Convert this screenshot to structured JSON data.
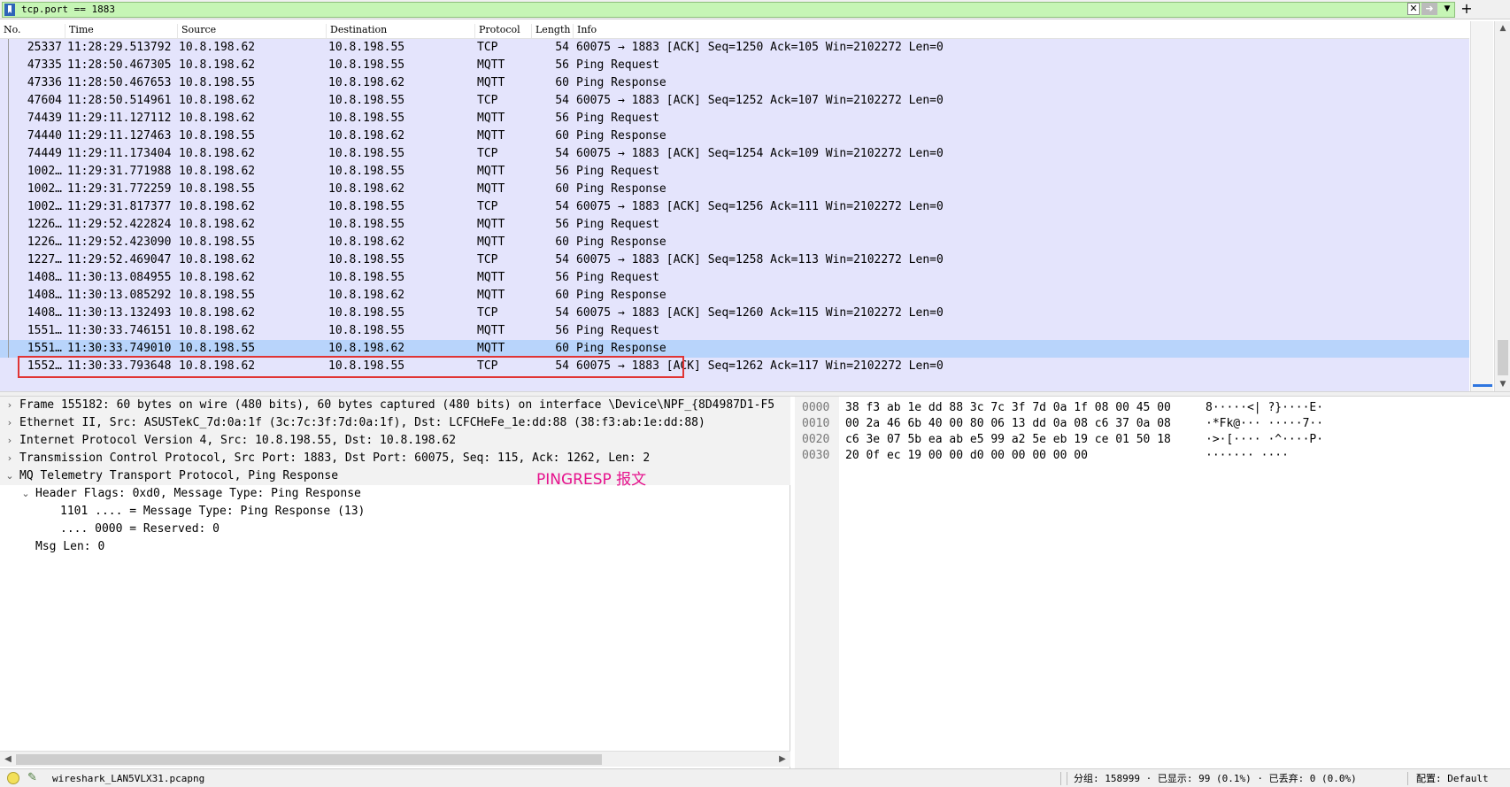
{
  "filter": {
    "value": "tcp.port == 1883"
  },
  "columns": [
    "No.",
    "Time",
    "Source",
    "Destination",
    "Protocol",
    "Length",
    "Info"
  ],
  "packets": [
    {
      "no": "25337",
      "time": "11:28:29.513792",
      "src": "10.8.198.62",
      "dst": "10.8.198.55",
      "proto": "TCP",
      "len": "54",
      "info": "60075 → 1883 [ACK] Seq=1250 Ack=105 Win=2102272 Len=0"
    },
    {
      "no": "47335",
      "time": "11:28:50.467305",
      "src": "10.8.198.62",
      "dst": "10.8.198.55",
      "proto": "MQTT",
      "len": "56",
      "info": "Ping Request"
    },
    {
      "no": "47336",
      "time": "11:28:50.467653",
      "src": "10.8.198.55",
      "dst": "10.8.198.62",
      "proto": "MQTT",
      "len": "60",
      "info": "Ping Response"
    },
    {
      "no": "47604",
      "time": "11:28:50.514961",
      "src": "10.8.198.62",
      "dst": "10.8.198.55",
      "proto": "TCP",
      "len": "54",
      "info": "60075 → 1883 [ACK] Seq=1252 Ack=107 Win=2102272 Len=0"
    },
    {
      "no": "74439",
      "time": "11:29:11.127112",
      "src": "10.8.198.62",
      "dst": "10.8.198.55",
      "proto": "MQTT",
      "len": "56",
      "info": "Ping Request"
    },
    {
      "no": "74440",
      "time": "11:29:11.127463",
      "src": "10.8.198.55",
      "dst": "10.8.198.62",
      "proto": "MQTT",
      "len": "60",
      "info": "Ping Response"
    },
    {
      "no": "74449",
      "time": "11:29:11.173404",
      "src": "10.8.198.62",
      "dst": "10.8.198.55",
      "proto": "TCP",
      "len": "54",
      "info": "60075 → 1883 [ACK] Seq=1254 Ack=109 Win=2102272 Len=0"
    },
    {
      "no": "1002…",
      "time": "11:29:31.771988",
      "src": "10.8.198.62",
      "dst": "10.8.198.55",
      "proto": "MQTT",
      "len": "56",
      "info": "Ping Request"
    },
    {
      "no": "1002…",
      "time": "11:29:31.772259",
      "src": "10.8.198.55",
      "dst": "10.8.198.62",
      "proto": "MQTT",
      "len": "60",
      "info": "Ping Response"
    },
    {
      "no": "1002…",
      "time": "11:29:31.817377",
      "src": "10.8.198.62",
      "dst": "10.8.198.55",
      "proto": "TCP",
      "len": "54",
      "info": "60075 → 1883 [ACK] Seq=1256 Ack=111 Win=2102272 Len=0"
    },
    {
      "no": "1226…",
      "time": "11:29:52.422824",
      "src": "10.8.198.62",
      "dst": "10.8.198.55",
      "proto": "MQTT",
      "len": "56",
      "info": "Ping Request"
    },
    {
      "no": "1226…",
      "time": "11:29:52.423090",
      "src": "10.8.198.55",
      "dst": "10.8.198.62",
      "proto": "MQTT",
      "len": "60",
      "info": "Ping Response"
    },
    {
      "no": "1227…",
      "time": "11:29:52.469047",
      "src": "10.8.198.62",
      "dst": "10.8.198.55",
      "proto": "TCP",
      "len": "54",
      "info": "60075 → 1883 [ACK] Seq=1258 Ack=113 Win=2102272 Len=0"
    },
    {
      "no": "1408…",
      "time": "11:30:13.084955",
      "src": "10.8.198.62",
      "dst": "10.8.198.55",
      "proto": "MQTT",
      "len": "56",
      "info": "Ping Request"
    },
    {
      "no": "1408…",
      "time": "11:30:13.085292",
      "src": "10.8.198.55",
      "dst": "10.8.198.62",
      "proto": "MQTT",
      "len": "60",
      "info": "Ping Response"
    },
    {
      "no": "1408…",
      "time": "11:30:13.132493",
      "src": "10.8.198.62",
      "dst": "10.8.198.55",
      "proto": "TCP",
      "len": "54",
      "info": "60075 → 1883 [ACK] Seq=1260 Ack=115 Win=2102272 Len=0"
    },
    {
      "no": "1551…",
      "time": "11:30:33.746151",
      "src": "10.8.198.62",
      "dst": "10.8.198.55",
      "proto": "MQTT",
      "len": "56",
      "info": "Ping Request"
    },
    {
      "no": "1551…",
      "time": "11:30:33.749010",
      "src": "10.8.198.55",
      "dst": "10.8.198.62",
      "proto": "MQTT",
      "len": "60",
      "info": "Ping Response",
      "selected": true
    },
    {
      "no": "1552…",
      "time": "11:30:33.793648",
      "src": "10.8.198.62",
      "dst": "10.8.198.55",
      "proto": "TCP",
      "len": "54",
      "info": "60075 → 1883 [ACK] Seq=1262 Ack=117 Win=2102272 Len=0"
    }
  ],
  "details": [
    {
      "indent": 0,
      "toggle": "collapsed",
      "text": "Frame 155182: 60 bytes on wire (480 bits), 60 bytes captured (480 bits) on interface \\Device\\NPF_{8D4987D1-F5"
    },
    {
      "indent": 0,
      "toggle": "collapsed",
      "text": "Ethernet II, Src: ASUSTekC_7d:0a:1f (3c:7c:3f:7d:0a:1f), Dst: LCFCHeFe_1e:dd:88 (38:f3:ab:1e:dd:88)"
    },
    {
      "indent": 0,
      "toggle": "collapsed",
      "text": "Internet Protocol Version 4, Src: 10.8.198.55, Dst: 10.8.198.62"
    },
    {
      "indent": 0,
      "toggle": "collapsed",
      "text": "Transmission Control Protocol, Src Port: 1883, Dst Port: 60075, Seq: 115, Ack: 1262, Len: 2"
    },
    {
      "indent": 0,
      "toggle": "expanded",
      "text": "MQ Telemetry Transport Protocol, Ping Response"
    },
    {
      "indent": 1,
      "toggle": "expanded",
      "text": "Header Flags: 0xd0, Message Type: Ping Response"
    },
    {
      "indent": 2,
      "toggle": "none",
      "text": "1101 .... = Message Type: Ping Response (13)"
    },
    {
      "indent": 2,
      "toggle": "none",
      "text": ".... 0000 = Reserved: 0"
    },
    {
      "indent": 1,
      "toggle": "none",
      "text": "Msg Len: 0"
    }
  ],
  "annotation": "PINGRESP 报文",
  "bytes": [
    {
      "offset": "0000",
      "hex": "38 f3 ab 1e dd 88 3c 7c  3f 7d 0a 1f 08 00 45 00",
      "ascii": "8·····<| ?}····E·"
    },
    {
      "offset": "0010",
      "hex": "00 2a 46 6b 40 00 80 06  13 dd 0a 08 c6 37 0a 08",
      "ascii": "·*Fk@··· ·····7··"
    },
    {
      "offset": "0020",
      "hex": "c6 3e 07 5b ea ab e5 99  a2 5e eb 19 ce 01 50 18",
      "ascii": "·>·[···· ·^····P·"
    },
    {
      "offset": "0030",
      "hex": "20 0f ec 19 00 00 d0 00  00 00 00 00",
      "ascii": " ······· ····"
    }
  ],
  "status": {
    "file": "wireshark_LAN5VLX31.pcapng",
    "stats": "分组: 158999 · 已显示: 99 (0.1%) · 已丢弃: 0 (0.0%)",
    "profile": "配置: Default"
  },
  "icons": {
    "filter_bookmark": "bookmark-icon",
    "filter_clear": "clear-icon",
    "filter_apply": "apply-arrow-icon",
    "filter_dropdown": "chevron-down-icon",
    "filter_add": "plus-icon",
    "expert": "ready-status-icon",
    "comment": "edit-comment-icon"
  },
  "colors": {
    "filter_valid": "#c6f5b5",
    "row_bg": "#e4e4fc",
    "selected_row": "#b8d4fb",
    "highlight_box": "#e03535",
    "annotation": "#e6138d"
  }
}
